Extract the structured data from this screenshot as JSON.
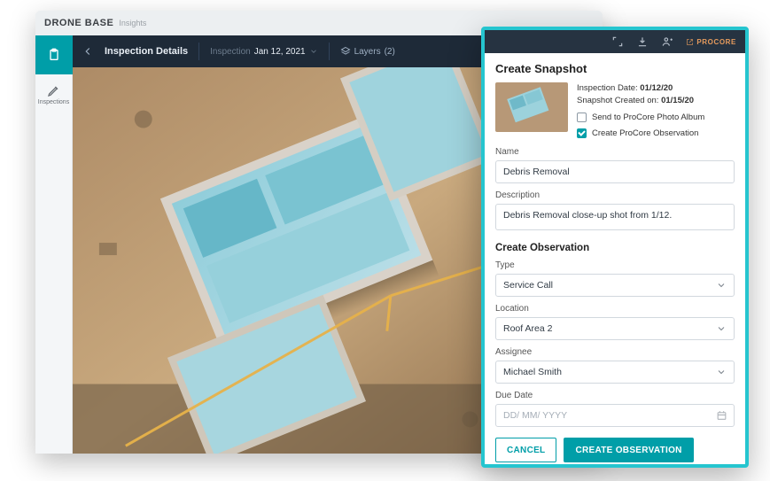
{
  "brand": {
    "name": "DRONE BASE",
    "sub": "Insights"
  },
  "rail": {
    "items": [
      {
        "icon": "clipboard",
        "label": ""
      },
      {
        "icon": "pencil",
        "label": "Inspections"
      }
    ]
  },
  "toolbar": {
    "title": "Inspection Details",
    "meta_label": "Inspection",
    "date": "Jan 12, 2021",
    "layers_label": "Layers",
    "layers_count": "(2)"
  },
  "panel": {
    "title": "Create Snapshot",
    "inspection_date_label": "Inspection Date:",
    "inspection_date_value": "01/12/20",
    "snapshot_created_label": "Snapshot Created on:",
    "snapshot_created_value": "01/15/20",
    "chk_send_label": "Send to ProCore Photo Album",
    "chk_send_checked": false,
    "chk_obs_label": "Create ProCore Observation",
    "chk_obs_checked": true,
    "name_label": "Name",
    "name_value": "Debris Removal",
    "description_label": "Description",
    "description_value": "Debris Removal close-up shot from 1/12.",
    "section_observation": "Create Observation",
    "type_label": "Type",
    "type_value": "Service Call",
    "location_label": "Location",
    "location_value": "Roof Area 2",
    "assignee_label": "Assignee",
    "assignee_value": "Michael Smith",
    "due_label": "Due Date",
    "due_placeholder": "DD/ MM/ YYYY",
    "cancel": "Cancel",
    "create": "Create Observation",
    "procore": "PROCORE"
  }
}
